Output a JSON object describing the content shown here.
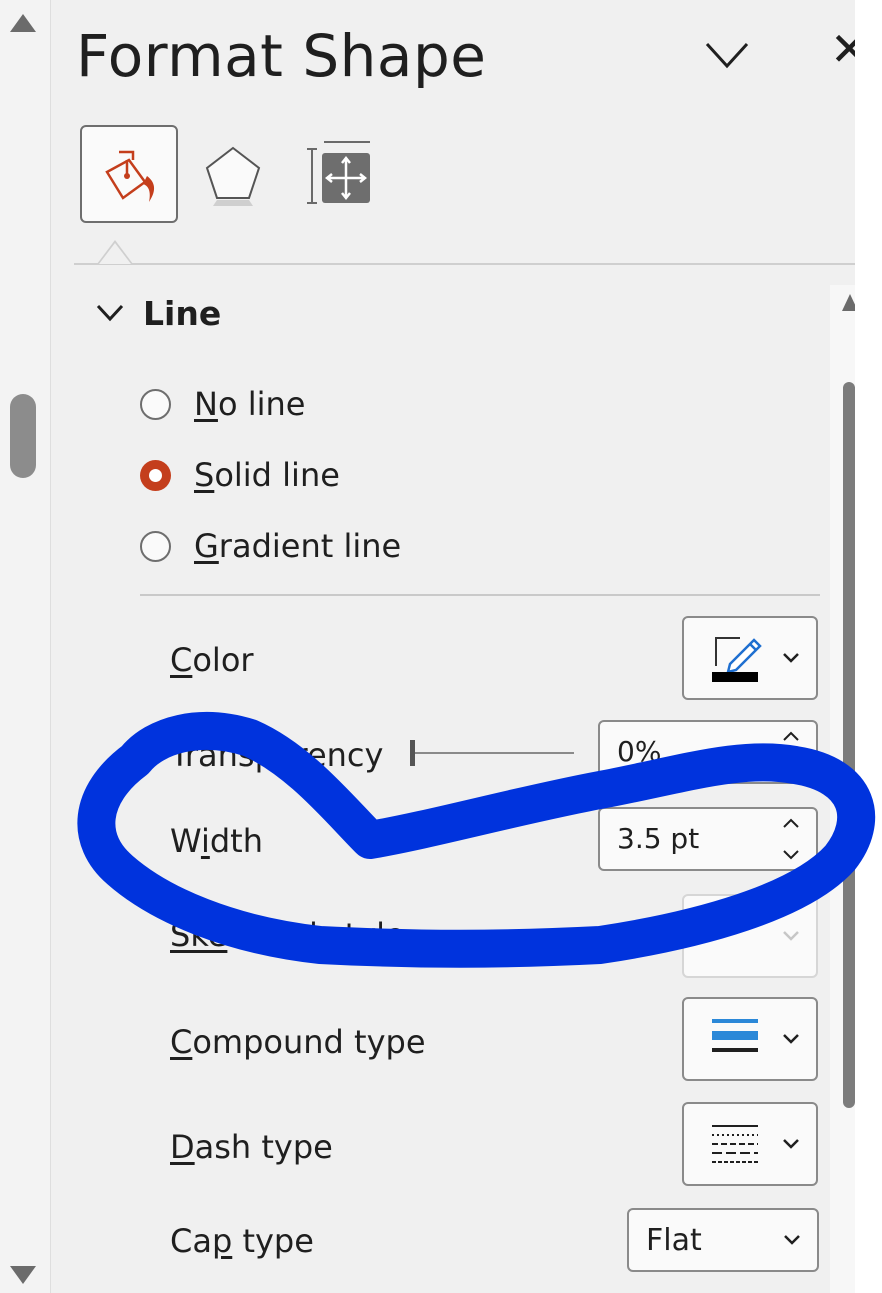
{
  "pane": {
    "title": "Format Shape",
    "tabs": [
      {
        "name": "Fill & Line",
        "icon": "paint-bucket-icon",
        "selected": true
      },
      {
        "name": "Effects",
        "icon": "pentagon-icon",
        "selected": false
      },
      {
        "name": "Size & Properties",
        "icon": "size-position-icon",
        "selected": false
      }
    ]
  },
  "line_section": {
    "title": "Line",
    "options": [
      {
        "accel": "N",
        "rest": "o line",
        "selected": false
      },
      {
        "accel": "S",
        "rest": "olid line",
        "selected": true
      },
      {
        "accel": "G",
        "rest": "radient line",
        "selected": false
      }
    ],
    "properties": {
      "color": {
        "accel": "C",
        "rest": "olor",
        "swatch": "#000000"
      },
      "transparency": {
        "prefix": "",
        "mid": "Tra",
        "rest": "nsparency",
        "value": "0%"
      },
      "width": {
        "pre": "W",
        "accel": "i",
        "rest": "dth",
        "value": "3.5 pt"
      },
      "sketched": {
        "accel": "Ske",
        "rest": "tched style"
      },
      "compound": {
        "accel": "C",
        "rest": "ompound type"
      },
      "dash": {
        "accel": "D",
        "rest": "ash type"
      },
      "cap": {
        "pre": "Ca",
        "accel": "p",
        "rest": " type",
        "value": "Flat"
      }
    }
  },
  "colors": {
    "accent": "#c43e1c",
    "annotation": "#0033dd",
    "compound_icon": "#2b88d8"
  }
}
